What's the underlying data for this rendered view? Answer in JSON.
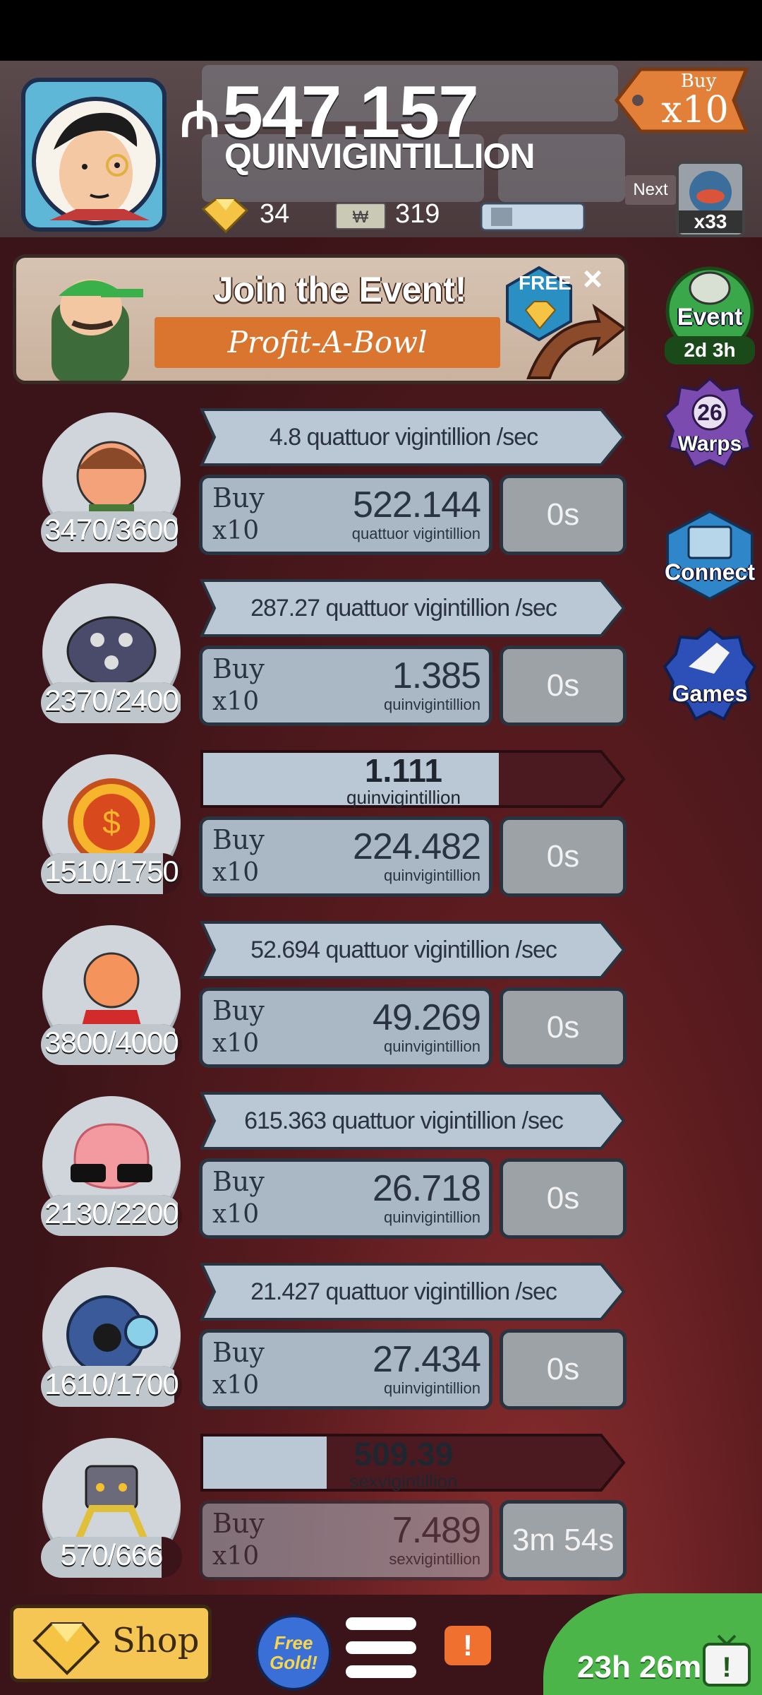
{
  "header": {
    "currency_symbol": "₼",
    "money_value": "547.157",
    "money_unit": "QUINVIGINTILLION",
    "gold_count": "34",
    "megabucks_count": "319",
    "buy_multiplier": {
      "top": "Buy",
      "bottom": "x10"
    },
    "next_label": "Next",
    "next_count": "x33"
  },
  "event_banner": {
    "title": "Join the Event!",
    "event_name": "Profit-A-Bowl",
    "free_badge": "FREE",
    "close_glyph": "×"
  },
  "side_buttons": [
    {
      "label": "Event",
      "sub": "2d 3h"
    },
    {
      "label": "Warps",
      "badge": "26"
    },
    {
      "label": "Connect"
    },
    {
      "label": "Games"
    }
  ],
  "managers": [
    {
      "count": "3470/3600",
      "count_fraction": 0.964,
      "rate": "4.8 quattuor vigintillion /sec",
      "cost": "522.144",
      "cost_unit": "quattuor vigintillion",
      "buy_word": "Buy",
      "buy_mult": "x10",
      "time": "0s"
    },
    {
      "count": "2370/2400",
      "count_fraction": 0.9875,
      "rate": "287.27 quattuor vigintillion /sec",
      "cost": "1.385",
      "cost_unit": "quinvigintillion",
      "buy_word": "Buy",
      "buy_mult": "x10",
      "time": "0s"
    },
    {
      "count": "1510/1750",
      "count_fraction": 0.863,
      "progress_value": "1.111",
      "progress_unit": "quinvigintillion",
      "progress_fraction": 0.72,
      "cost": "224.482",
      "cost_unit": "quinvigintillion",
      "buy_word": "Buy",
      "buy_mult": "x10",
      "time": "0s"
    },
    {
      "count": "3800/4000",
      "count_fraction": 0.95,
      "rate": "52.694 quattuor vigintillion /sec",
      "cost": "49.269",
      "cost_unit": "quinvigintillion",
      "buy_word": "Buy",
      "buy_mult": "x10",
      "time": "0s"
    },
    {
      "count": "2130/2200",
      "count_fraction": 0.968,
      "rate": "615.363 quattuor vigintillion /sec",
      "cost": "26.718",
      "cost_unit": "quinvigintillion",
      "buy_word": "Buy",
      "buy_mult": "x10",
      "time": "0s"
    },
    {
      "count": "1610/1700",
      "count_fraction": 0.947,
      "rate": "21.427 quattuor vigintillion /sec",
      "cost": "27.434",
      "cost_unit": "quinvigintillion",
      "buy_word": "Buy",
      "buy_mult": "x10",
      "time": "0s"
    },
    {
      "count": "570/666",
      "count_fraction": 0.856,
      "progress_value": "509.39",
      "progress_unit": "sexvigintillion",
      "progress_fraction": 0.3,
      "cost": "7.489",
      "cost_unit": "sexvigintillion",
      "buy_word": "Buy",
      "buy_mult": "x10",
      "time": "3m 54s"
    }
  ],
  "bottom": {
    "shop_label": "Shop",
    "free_gold_line1": "Free",
    "free_gold_line2": "Gold!",
    "alert_glyph": "!",
    "timer": "23h 26m",
    "tv_glyph": "!"
  },
  "colors": {
    "rate_bar": "#b9c8d4",
    "progress_dark": "#4a1a20",
    "buy_button": "#a9b8c4",
    "event_green": "#3aa84a",
    "warps_purple": "#7b4bb0",
    "connect_blue": "#2f86c8",
    "games_blue": "#2c4fb8",
    "shop_yellow": "#f6c655"
  }
}
